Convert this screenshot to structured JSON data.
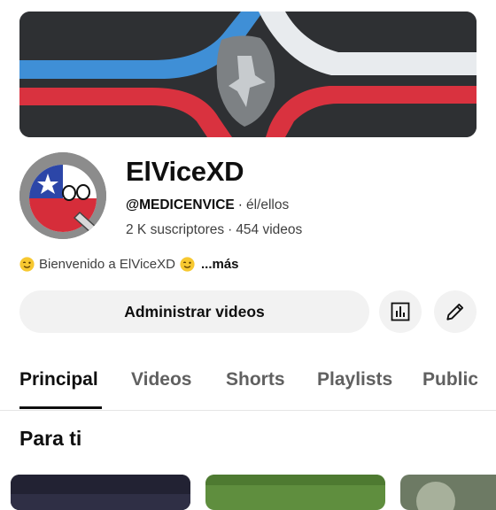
{
  "channel": {
    "name": "ElViceXD",
    "handle": "@MEDICENVICE",
    "pronouns": "él/ellos",
    "subscribers": "2 K suscriptores",
    "videos": "454 videos",
    "description": "Bienvenido a ElViceXD",
    "more_label": "...más"
  },
  "actions": {
    "manage_label": "Administrar videos",
    "analytics_icon": "bar-chart-icon",
    "edit_icon": "pencil-icon"
  },
  "tabs": [
    {
      "label": "Principal",
      "active": true
    },
    {
      "label": "Videos"
    },
    {
      "label": "Shorts"
    },
    {
      "label": "Playlists"
    },
    {
      "label": "Public"
    }
  ],
  "section": {
    "title": "Para ti"
  },
  "colors": {
    "banner_blue": "#3f8fd6",
    "banner_red": "#d9323f",
    "banner_white": "#e9ecef",
    "button_bg": "#f2f2f2"
  }
}
